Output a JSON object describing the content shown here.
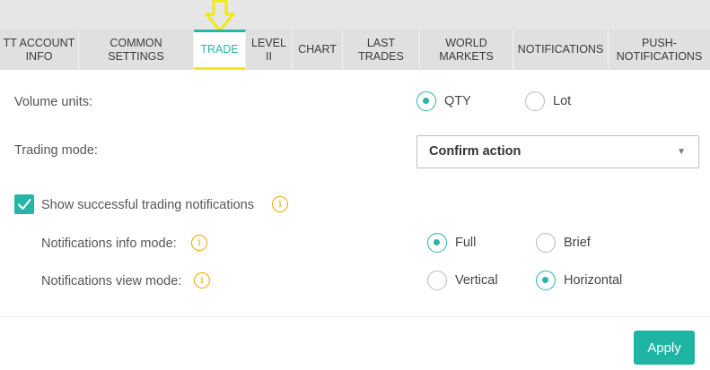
{
  "tabs": [
    {
      "label": "TT ACCOUNT INFO"
    },
    {
      "label": "COMMON SETTINGS"
    },
    {
      "label": "TRADE",
      "active": true
    },
    {
      "label": "LEVEL II"
    },
    {
      "label": "CHART"
    },
    {
      "label": "LAST TRADES"
    },
    {
      "label": "WORLD MARKETS"
    },
    {
      "label": "NOTIFICATIONS"
    },
    {
      "label": "PUSH-NOTIFICATIONS"
    }
  ],
  "volume_units": {
    "label": "Volume units:",
    "options": [
      "QTY",
      "Lot"
    ],
    "selected": "QTY"
  },
  "trading_mode": {
    "label": "Trading mode:",
    "value": "Confirm action",
    "caret": "▼"
  },
  "show_notifications": {
    "label": "Show successful trading notifications",
    "checked": true
  },
  "info_mode": {
    "label": "Notifications info mode:",
    "options": [
      "Full",
      "Brief"
    ],
    "selected": "Full"
  },
  "view_mode": {
    "label": "Notifications view mode:",
    "options": [
      "Vertical",
      "Horizontal"
    ],
    "selected": "Horizontal"
  },
  "info_glyph": "i",
  "apply_label": "Apply",
  "colors": {
    "accent": "#26b5a6",
    "highlight": "#f2ea14",
    "info": "#f0a800"
  }
}
